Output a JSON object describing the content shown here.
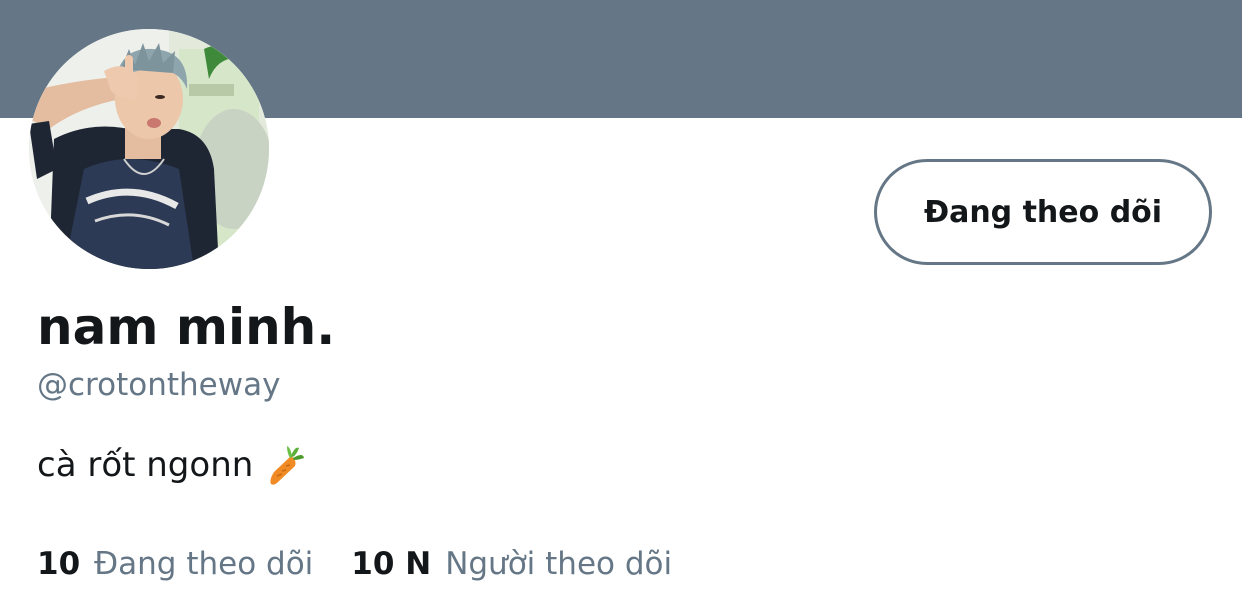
{
  "profile": {
    "display_name": "nam minh.",
    "handle": "@crotontheway",
    "bio": "cà rốt ngonn",
    "bio_emoji": "carrot",
    "follow_button_label": "Đang theo dõi"
  },
  "stats": [
    {
      "count": "10",
      "label": "Đang theo dõi"
    },
    {
      "count": "10 N",
      "label": "Người theo dõi"
    }
  ],
  "colors": {
    "banner": "#657786",
    "primary_text": "#14171a",
    "secondary_text": "#657786",
    "button_border": "#657786"
  }
}
